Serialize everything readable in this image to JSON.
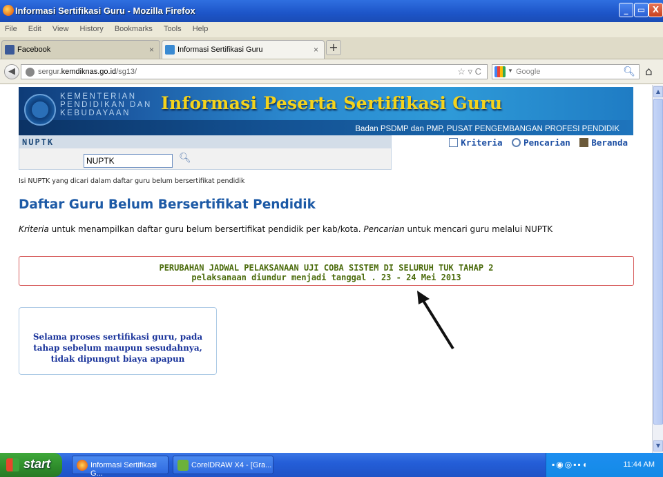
{
  "window": {
    "title": "Informasi Sertifikasi Guru - Mozilla Firefox",
    "controls": {
      "minimize": "_",
      "maximize": "▭",
      "close": "X"
    }
  },
  "menu": [
    "File",
    "Edit",
    "View",
    "History",
    "Bookmarks",
    "Tools",
    "Help"
  ],
  "tabs": [
    {
      "label": "Facebook",
      "close": "×",
      "active": false,
      "icon_color": "#3b5998"
    },
    {
      "label": "Informasi Sertifikasi Guru",
      "close": "×",
      "active": true,
      "icon_color": "#3a8ad2"
    }
  ],
  "newtab_label": "+",
  "nav": {
    "back_icon": "back-arrow-icon",
    "url_prefix": "sergur.",
    "url_host": "kemdiknas.go.id",
    "url_path": "/sg13/",
    "url_icons": "☆ ▿ C",
    "search_placeholder": "Google"
  },
  "banner": {
    "ministry": "KEMENTERIAN PENDIDIKAN DAN KEBUDAYAAN",
    "heading": "Informasi Peserta Sertifikasi Guru",
    "sub": "Badan PSDMP dan PMP, PUSAT PENGEMBANGAN PROFESI PENDIDIK"
  },
  "nuptk": {
    "header": "NUPTK",
    "value": "NUPTK"
  },
  "links": [
    "Kriteria",
    "Pencarian",
    "Beranda"
  ],
  "hint": "Isi NUPTK yang dicari dalam daftar guru belum bersertifikat pendidik",
  "page_title": "Daftar Guru Belum Bersertifikat Pendidik",
  "intro": {
    "kw1": "Kriteria",
    "text1": " untuk menampilkan daftar guru belum bersertifikat pendidik per kab/kota. ",
    "kw2": "Pencarian",
    "text2": " untuk mencari guru melalui NUPTK"
  },
  "notice": {
    "line1": "PERUBAHAN JADWAL PELAKSANAAN UJI COBA SISTEM DI SELURUH TUK TAHAP 2",
    "line2": "pelaksanaan diundur menjadi tanggal . 23 - 24 Mei 2013"
  },
  "infobox": "Selama proses sertifikasi guru, pada tahap sebelum maupun sesudahnya, tidak dipungut biaya apapun",
  "taskbar": {
    "start": "start",
    "items": [
      "Informasi Sertifikasi G...",
      "CorelDRAW X4 - [Gra..."
    ],
    "clock": "11:44 AM"
  },
  "colors": {
    "accent": "#1d5aa6",
    "notice_border": "#d65a5a",
    "notice_text": "#4b6b0c",
    "banner_title": "#f4d31c"
  }
}
